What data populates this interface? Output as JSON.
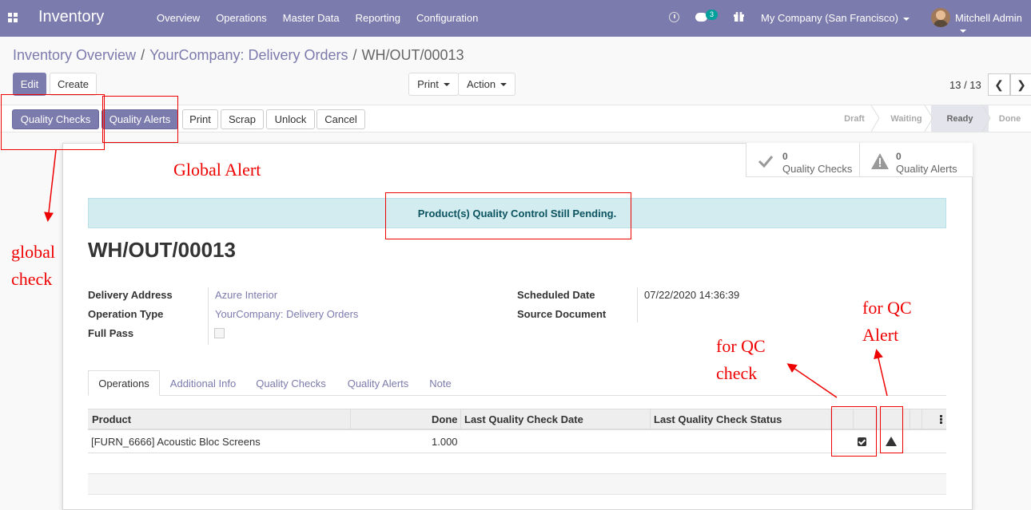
{
  "navbar": {
    "app_title": "Inventory",
    "menu": [
      "Overview",
      "Operations",
      "Master Data",
      "Reporting",
      "Configuration"
    ],
    "chat_count": "3",
    "company": "My Company (San Francisco)",
    "user": "Mitchell Admin"
  },
  "breadcrumb": {
    "items": [
      "Inventory Overview",
      "YourCompany: Delivery Orders"
    ],
    "current": "WH/OUT/00013",
    "separator": "/"
  },
  "control": {
    "edit": "Edit",
    "create": "Create",
    "print": "Print",
    "action": "Action",
    "pager": "13 / 13"
  },
  "header_buttons": {
    "quality_checks": "Quality Checks",
    "quality_alerts": "Quality Alerts",
    "print": "Print",
    "scrap": "Scrap",
    "unlock": "Unlock",
    "cancel": "Cancel"
  },
  "stages": [
    "Draft",
    "Waiting",
    "Ready",
    "Done"
  ],
  "active_stage": "Ready",
  "smart_buttons": {
    "checks": {
      "count": "0",
      "label": "Quality Checks"
    },
    "alerts": {
      "count": "0",
      "label": "Quality Alerts"
    }
  },
  "alert_message": "Product(s) Quality Control Still Pending.",
  "record_title": "WH/OUT/00013",
  "fields": {
    "delivery_address": {
      "label": "Delivery Address",
      "value": "Azure Interior"
    },
    "operation_type": {
      "label": "Operation Type",
      "value": "YourCompany: Delivery Orders"
    },
    "full_pass": {
      "label": "Full Pass",
      "checked": false
    },
    "scheduled_date": {
      "label": "Scheduled Date",
      "value": "07/22/2020 14:36:39"
    },
    "source_document": {
      "label": "Source Document",
      "value": ""
    }
  },
  "tabs": [
    "Operations",
    "Additional Info",
    "Quality Checks",
    "Quality Alerts",
    "Note"
  ],
  "table": {
    "headers": [
      "Product",
      "Done",
      "Last Quality Check Date",
      "Last Quality Check Status"
    ],
    "rows": [
      {
        "product": "[FURN_6666] Acoustic Bloc Screens",
        "done": "1.000",
        "date": "",
        "status": ""
      }
    ]
  },
  "annotations": {
    "global_alert": "Global Alert",
    "global_check_line1": "global",
    "global_check_line2": "check",
    "qc_check_line1": "for QC",
    "qc_check_line2": "check",
    "qc_alert_line1": "for QC",
    "qc_alert_line2": "Alert"
  },
  "colors": {
    "brand": "#7c7bad",
    "annotation": "#e00000",
    "info_bg": "#d2ecf0"
  }
}
